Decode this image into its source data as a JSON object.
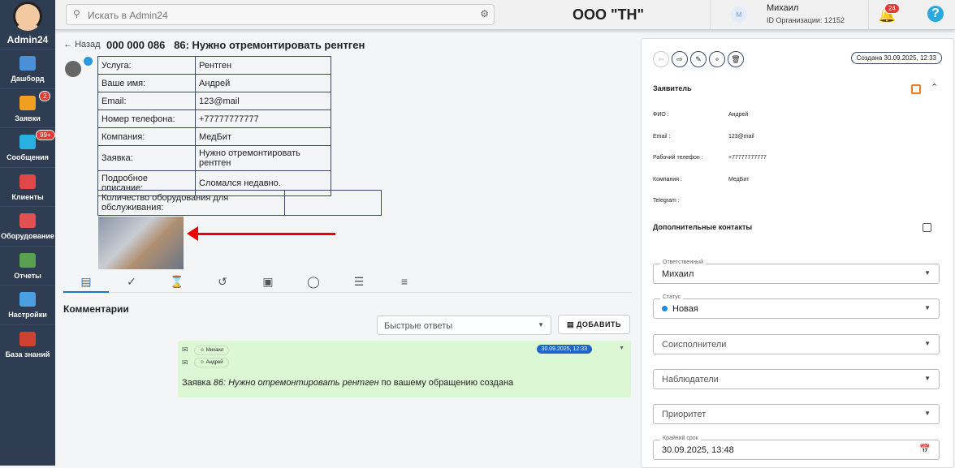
{
  "sidebar": {
    "brand": "Admin24",
    "items": [
      {
        "label": "Дашборд",
        "color": "#4a90d9"
      },
      {
        "label": "Заявки",
        "badge": "2",
        "color": "#f0a020"
      },
      {
        "label": "Сообщения",
        "badge": "99+",
        "color": "#2ab0e0"
      },
      {
        "label": "Клиенты",
        "color": "#e04848"
      },
      {
        "label": "Оборудование",
        "color": "#e05050"
      },
      {
        "label": "Отчеты",
        "color": "#5aa050"
      },
      {
        "label": "Настройки",
        "color": "#4aa0e0"
      },
      {
        "label": "База знаний",
        "color": "#d04030"
      }
    ]
  },
  "topbar": {
    "search_placeholder": "Искать в Admin24",
    "org": "ООО \"ТН\"",
    "user_initial": "M",
    "user_name": "Михаил",
    "org_id": "ID Организации: 12152",
    "notifications": "24",
    "help": "?"
  },
  "ticket": {
    "back": "Назад",
    "number": "000 000 086",
    "title": "86: Нужно отремонтировать рентген",
    "fields": [
      [
        "Услуга:",
        "Рентген"
      ],
      [
        "Ваше имя:",
        "Андрей"
      ],
      [
        "Email:",
        "123@mail"
      ],
      [
        "Номер телефона:",
        "+77777777777"
      ],
      [
        "Компания:",
        "МедБит"
      ],
      [
        "Заявка:",
        "Нужно отремонтировать рентген"
      ],
      [
        "Подробное описание:",
        "Сломался недавно."
      ]
    ],
    "equipment_label": "Количество оборудования для обслуживания:",
    "equipment_value": ""
  },
  "comments": {
    "title": "Комментарии",
    "quick_replies": "Быстрые ответы",
    "add": "ДОБАВИТЬ",
    "message": {
      "from": "Михаил",
      "to": "Андрей",
      "date": "30.09.2025, 12:33",
      "prefix": "Заявка ",
      "italic": "86: Нужно отремонтировать рентген",
      "suffix": " по вашему обращению создана"
    }
  },
  "panel": {
    "created": "Создана 30.09.2025, 12:33",
    "applicant_title": "Заявитель",
    "applicant": [
      [
        "ФИО :",
        "Андрей"
      ],
      [
        "Email :",
        "123@mail"
      ],
      [
        "Рабочий телефон :",
        "+77777777777"
      ],
      [
        "Компания :",
        "МедБит"
      ],
      [
        "Telegram :",
        ""
      ]
    ],
    "extra_contacts": "Дополнительные контакты",
    "responsible_label": "Ответственный",
    "responsible": "Михаил",
    "status_label": "Статус",
    "status": "Новая",
    "status_color": "#1e88e5",
    "coexecutors": "Соисполнители",
    "observers": "Наблюдатели",
    "priority": "Приоритет",
    "deadline_label": "Крайний срок",
    "deadline": "30.09.2025, 13:48"
  }
}
